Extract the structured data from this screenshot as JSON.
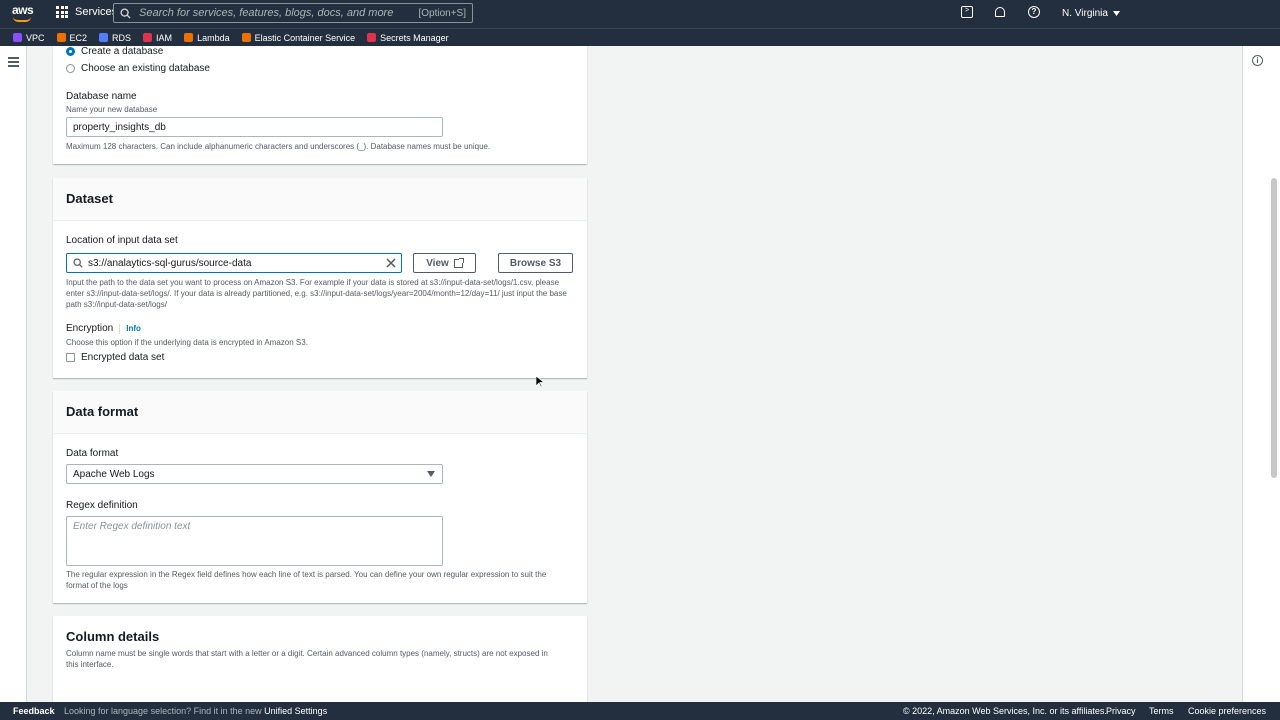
{
  "topnav": {
    "logo": "aws",
    "services_label": "Services",
    "search_placeholder": "Search for services, features, blogs, docs, and more",
    "search_shortcut": "[Option+S]",
    "region": "N. Virginia"
  },
  "favorites": [
    {
      "label": "VPC",
      "color": "#8c4fff"
    },
    {
      "label": "EC2",
      "color": "#ed7100"
    },
    {
      "label": "RDS",
      "color": "#527fff"
    },
    {
      "label": "IAM",
      "color": "#dd344c"
    },
    {
      "label": "Lambda",
      "color": "#ed7100"
    },
    {
      "label": "Elastic Container Service",
      "color": "#ed7100"
    },
    {
      "label": "Secrets Manager",
      "color": "#dd344c"
    }
  ],
  "database": {
    "option_create": "Create a database",
    "option_existing": "Choose an existing database",
    "name_label": "Database name",
    "name_desc": "Name your new database",
    "name_value": "property_insights_db",
    "name_hint": "Maximum 128 characters. Can include alphanumeric characters and underscores (_). Database names must be unique."
  },
  "dataset": {
    "title": "Dataset",
    "location_label": "Location of input data set",
    "location_value": "s3://analaytics-sql-gurus/source-data",
    "view_label": "View",
    "browse_label": "Browse S3",
    "location_hint": "Input the path to the data set you want to process on Amazon S3. For example if your data is stored at s3://input-data-set/logs/1.csv, please enter s3://input-data-set/logs/. If your data is already partitioned, e.g. s3://input-data-set/logs/year=2004/month=12/day=11/ just input the base path s3://input-data-set/logs/",
    "encryption_label": "Encryption",
    "info_label": "Info",
    "encryption_desc": "Choose this option if the underlying data is encrypted in Amazon S3.",
    "encrypted_label": "Encrypted data set"
  },
  "data_format": {
    "title": "Data format",
    "format_label": "Data format",
    "format_value": "Apache Web Logs",
    "regex_label": "Regex definition",
    "regex_placeholder": "Enter Regex definition text",
    "regex_hint": "The regular expression in the Regex field defines how each line of text is parsed. You can define your own regular expression to suit the format of the logs"
  },
  "column_details": {
    "title": "Column details",
    "desc": "Column name must be single words that start with a letter or a digit. Certain advanced column types (namely, structs) are not exposed in this interface."
  },
  "footer": {
    "feedback": "Feedback",
    "lang_text": "Looking for language selection? Find it in the new",
    "unified_settings": "Unified Settings",
    "copyright": "© 2022, Amazon Web Services, Inc. or its affiliates.",
    "privacy": "Privacy",
    "terms": "Terms",
    "cookie": "Cookie preferences"
  }
}
